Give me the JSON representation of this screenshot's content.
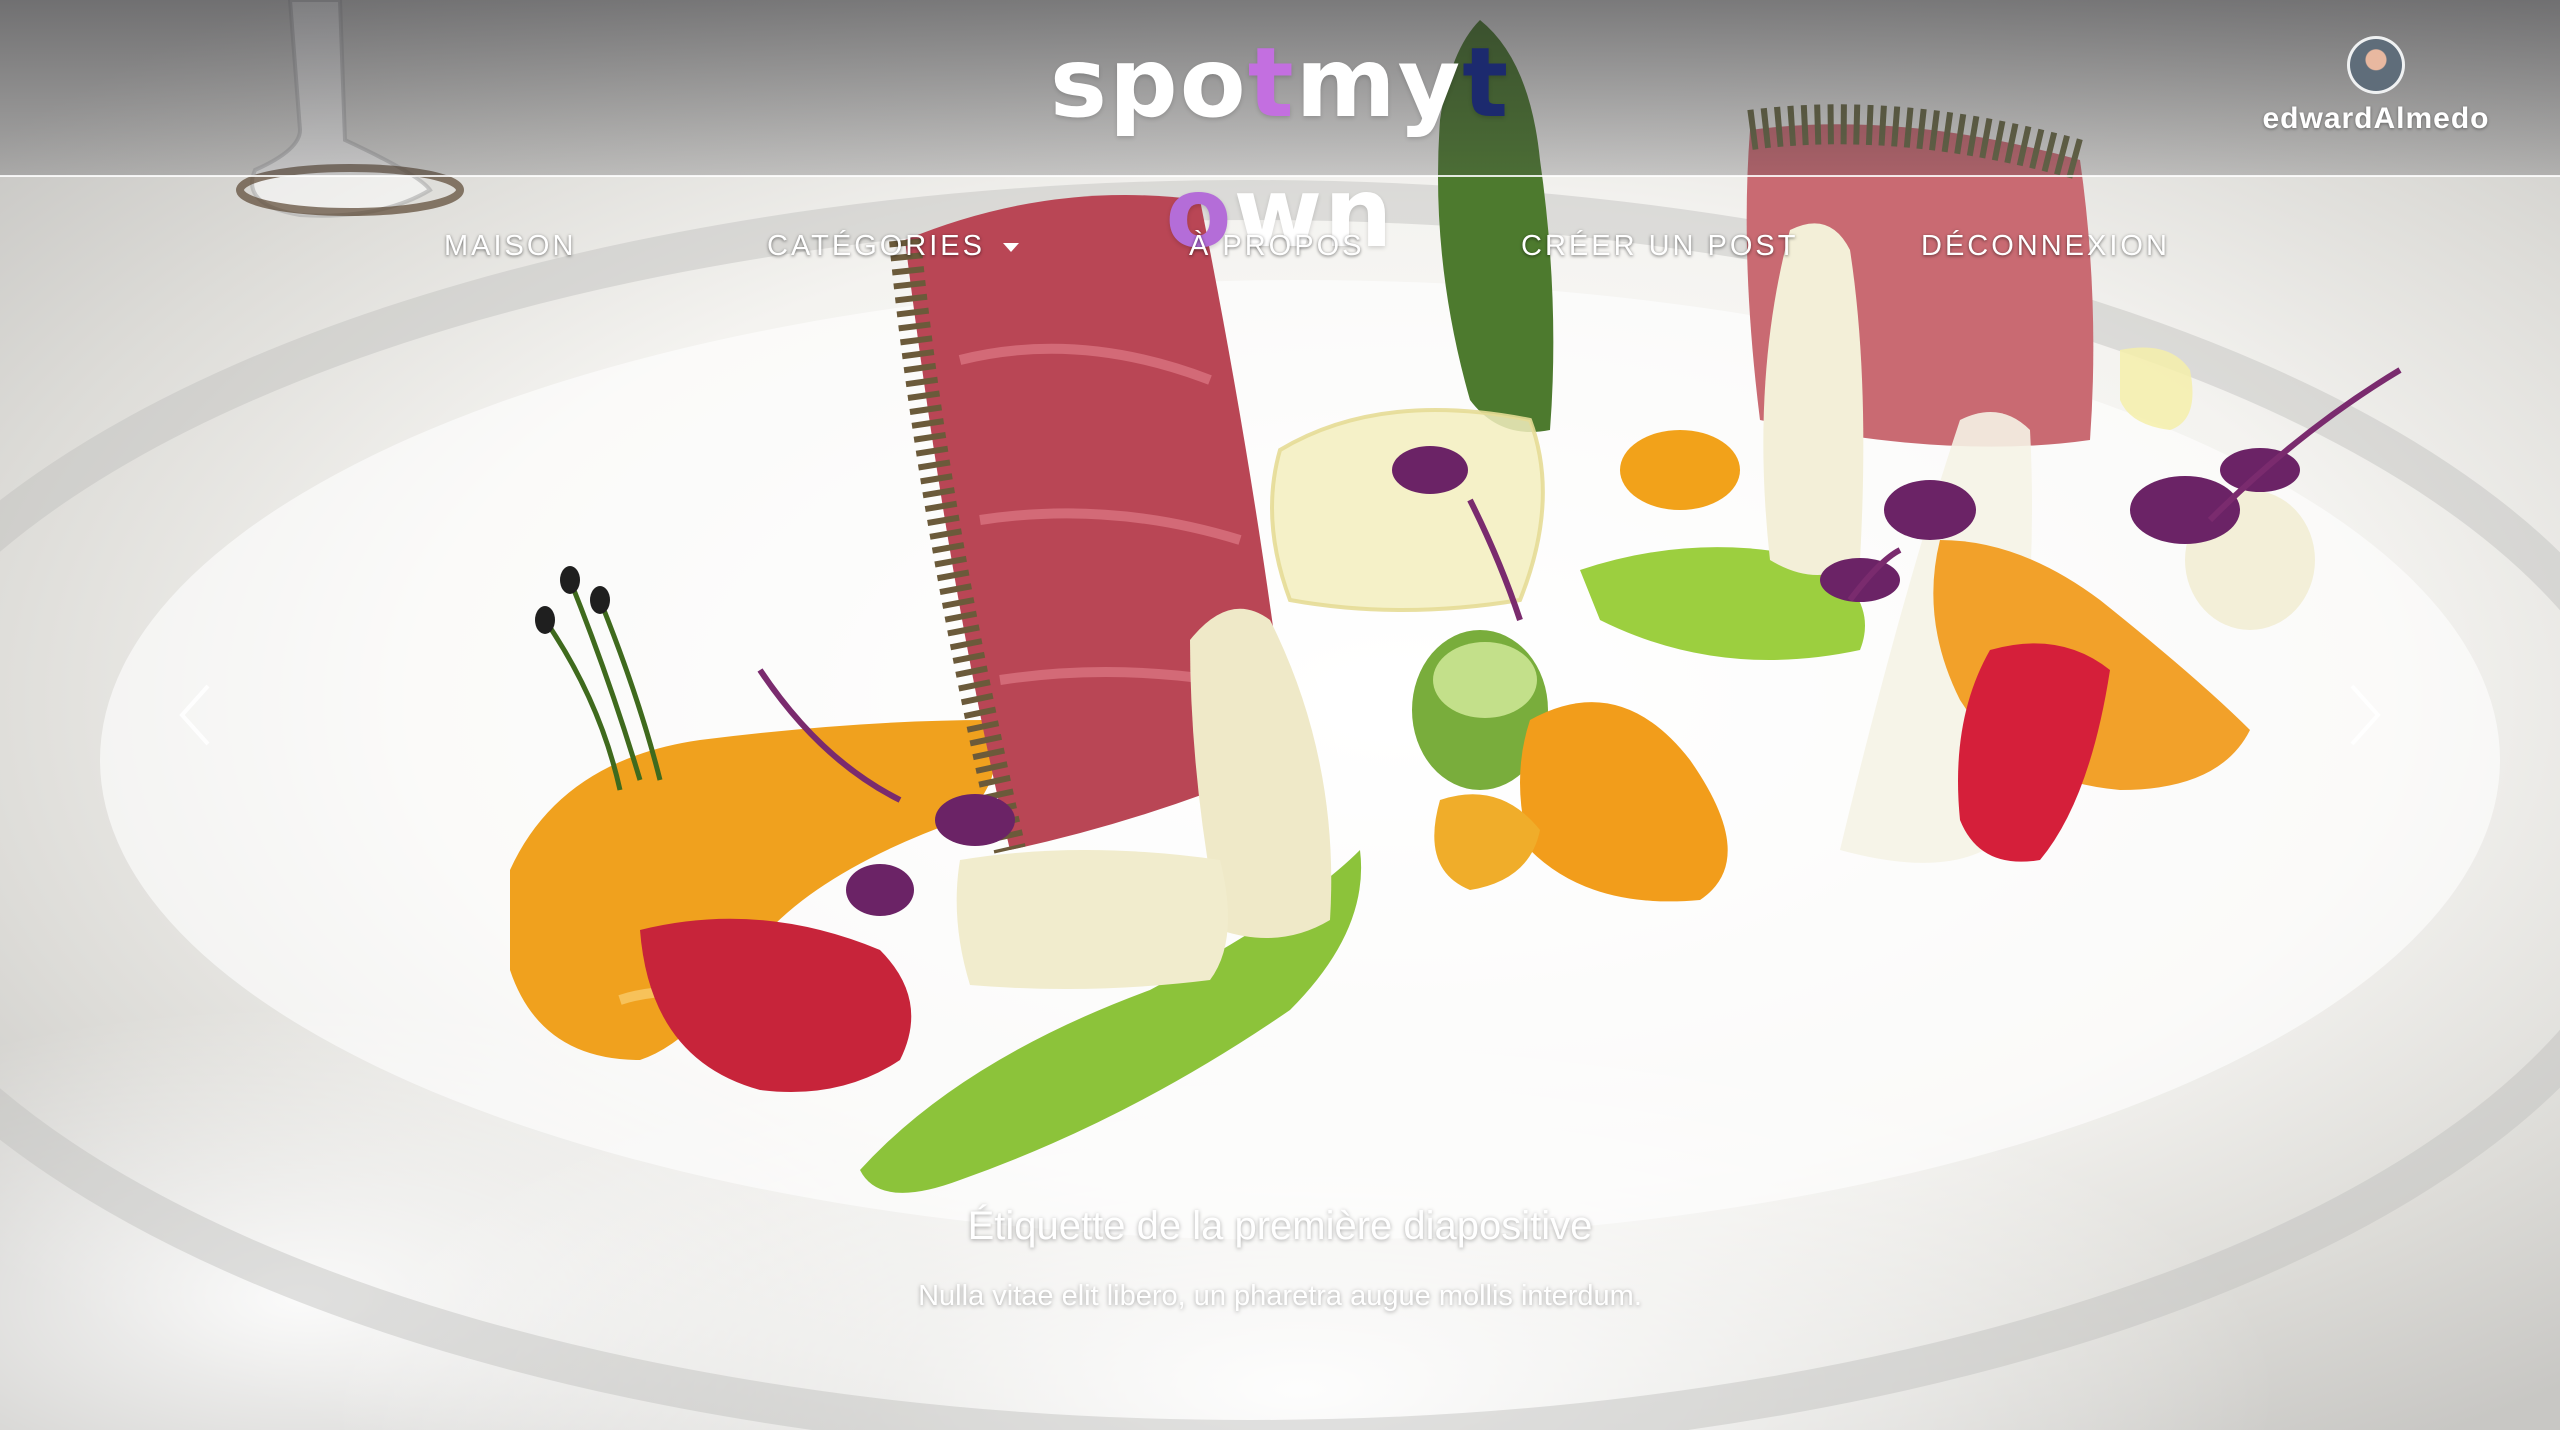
{
  "header": {
    "logo_letters": [
      "s",
      "p",
      "o",
      "t",
      "m",
      "y",
      "t",
      "o",
      "w",
      "n"
    ],
    "logo_colors": [
      "#ffffff",
      "#ffffff",
      "#ffffff",
      "#c36fe0",
      "#ffffff",
      "#ffffff",
      "#1c2a6e",
      "#b46dd8",
      "#ffffff",
      "#ffffff"
    ],
    "username": "edwardAlmedo"
  },
  "nav": {
    "home": "MAISON",
    "categories": "CATÉGORIES",
    "about": "À PROPOS",
    "create_post": "CRÉER UN POST",
    "logout": "DÉCONNEXION"
  },
  "carousel": {
    "caption_title": "Étiquette de la première diapositive",
    "caption_text": "Nulla vitae elit libero, un pharetra augue mollis interdum."
  },
  "icons": {
    "prev": "chevron-left-icon",
    "next": "chevron-right-icon",
    "dropdown": "caret-down-icon"
  }
}
